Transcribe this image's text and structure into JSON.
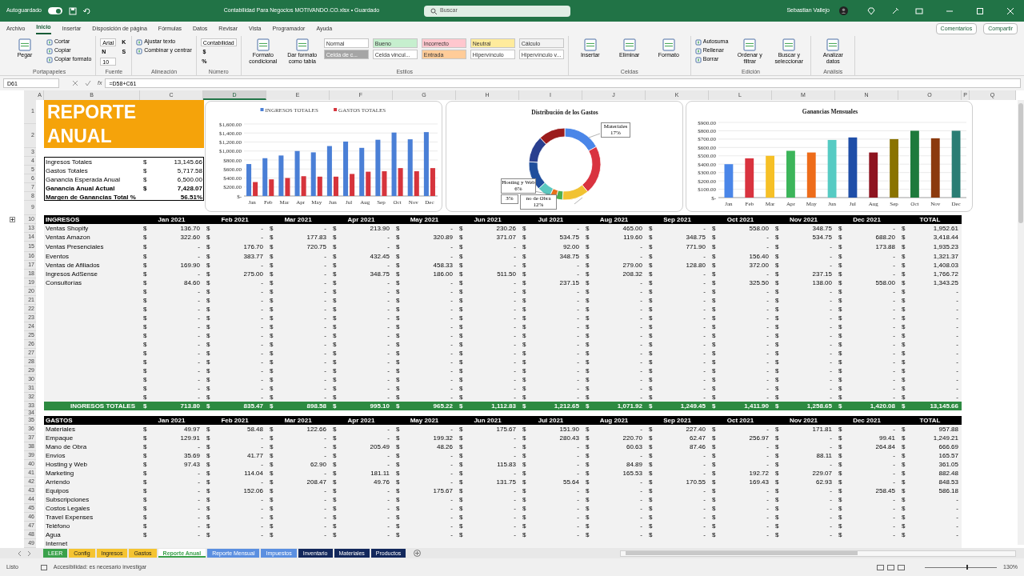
{
  "title_bar": {
    "autosave_label": "Autoguardado",
    "autosave_on": true,
    "document_title": "Contabilidad Para Negocios MOTIVANDO.CO.xlsx • Guardado",
    "search_placeholder": "Buscar",
    "user": "Sebastian Vallejo"
  },
  "menu_tabs": [
    {
      "label": "Archivo",
      "selected": false
    },
    {
      "label": "Inicio",
      "selected": true
    },
    {
      "label": "Insertar",
      "selected": false
    },
    {
      "label": "Disposición de página",
      "selected": false
    },
    {
      "label": "Fórmulas",
      "selected": false
    },
    {
      "label": "Datos",
      "selected": false
    },
    {
      "label": "Revisar",
      "selected": false
    },
    {
      "label": "Vista",
      "selected": false
    },
    {
      "label": "Programador",
      "selected": false
    },
    {
      "label": "Ayuda",
      "selected": false
    }
  ],
  "menu_actions": [
    "Comentarios",
    "Compartir"
  ],
  "ribbon": [
    {
      "label": "Portapapeles",
      "items": [
        {
          "kind": "large",
          "label": "Pegar"
        },
        {
          "kind": "small",
          "label": "Cortar"
        },
        {
          "kind": "small",
          "label": "Copiar"
        },
        {
          "kind": "small",
          "label": "Copiar formato"
        }
      ]
    },
    {
      "label": "Fuente",
      "items": [
        {
          "kind": "field",
          "label": "Arial"
        },
        {
          "kind": "char",
          "label": "N"
        },
        {
          "kind": "field",
          "label": "10"
        },
        {
          "kind": "char",
          "label": "K"
        },
        {
          "kind": "char",
          "label": "S"
        }
      ]
    },
    {
      "label": "Alineación",
      "items": [
        {
          "kind": "small",
          "label": "Ajustar texto"
        },
        {
          "kind": "small",
          "label": "Combinar y centrar"
        }
      ]
    },
    {
      "label": "Número",
      "items": [
        {
          "kind": "field",
          "label": "Contabilidad"
        },
        {
          "kind": "char",
          "label": "$"
        },
        {
          "kind": "char",
          "label": "%"
        }
      ]
    },
    {
      "label": "Estilos",
      "items": [
        {
          "kind": "large",
          "label": "Formato condicional"
        },
        {
          "kind": "large",
          "label": "Dar formato como tabla"
        },
        {
          "kind": "style",
          "label": "Normal",
          "color": "#ffffff"
        },
        {
          "kind": "style",
          "label": "Celda de c...",
          "color": "#a5a5a5"
        },
        {
          "kind": "style",
          "label": "Bueno",
          "color": "#c6efce"
        },
        {
          "kind": "style",
          "label": "Celda vincul...",
          "color": "#ffffff"
        },
        {
          "kind": "style",
          "label": "Incorrecto",
          "color": "#ffc7ce"
        },
        {
          "kind": "style",
          "label": "Entrada",
          "color": "#ffcc99"
        },
        {
          "kind": "style",
          "label": "Neutral",
          "color": "#ffeb9c"
        },
        {
          "kind": "style",
          "label": "Hipervínculo",
          "color": "#ffffff"
        },
        {
          "kind": "style",
          "label": "Cálculo",
          "color": "#f2f2f2"
        },
        {
          "kind": "style",
          "label": "Hipervínculo v...",
          "color": "#ffffff"
        }
      ]
    },
    {
      "label": "Celdas",
      "items": [
        {
          "kind": "large",
          "label": "Insertar"
        },
        {
          "kind": "large",
          "label": "Eliminar"
        },
        {
          "kind": "large",
          "label": "Formato"
        }
      ]
    },
    {
      "label": "Edición",
      "items": [
        {
          "kind": "small",
          "label": "Autosuma"
        },
        {
          "kind": "small",
          "label": "Rellenar"
        },
        {
          "kind": "small",
          "label": "Borrar"
        },
        {
          "kind": "large",
          "label": "Ordenar y filtrar"
        },
        {
          "kind": "large",
          "label": "Buscar y seleccionar"
        }
      ]
    },
    {
      "label": "Análisis",
      "items": [
        {
          "kind": "large",
          "label": "Analizar datos"
        }
      ]
    }
  ],
  "formula_bar": {
    "cell": "D61",
    "function_label": "fx",
    "formula": "=D58+C61"
  },
  "columns": [
    {
      "label": "A",
      "selected": false
    },
    {
      "label": "B",
      "selected": false
    },
    {
      "label": "C",
      "selected": false
    },
    {
      "label": "D",
      "selected": true
    },
    {
      "label": "E",
      "selected": false
    },
    {
      "label": "F",
      "selected": false
    },
    {
      "label": "G",
      "selected": false
    },
    {
      "label": "H",
      "selected": false
    },
    {
      "label": "I",
      "selected": false
    },
    {
      "label": "J",
      "selected": false
    },
    {
      "label": "K",
      "selected": false
    },
    {
      "label": "L",
      "selected": false
    },
    {
      "label": "M",
      "selected": false
    },
    {
      "label": "N",
      "selected": false
    },
    {
      "label": "O",
      "selected": false
    },
    {
      "label": "P",
      "selected": false
    },
    {
      "label": "Q",
      "selected": false
    }
  ],
  "top_rows": [
    "1",
    "2",
    "3",
    "4",
    "5",
    "6",
    "7",
    "8",
    "9"
  ],
  "report": {
    "title": "REPORTE ANUAL",
    "summary": [
      {
        "label": "Ingresos Totales",
        "currency": "$",
        "value": "13,145.66",
        "bold": false
      },
      {
        "label": "Gastos Totales",
        "currency": "$",
        "value": "5,717.58",
        "bold": false
      },
      {
        "label": "Ganancia Esperada Anual",
        "currency": "$",
        "value": "6,500.00",
        "bold": false
      },
      {
        "label": "Ganancia Anual Actual",
        "currency": "$",
        "value": "7,428.07",
        "bold": true
      },
      {
        "label": "Margen de Ganancias Total %",
        "value": "56.51%",
        "bold": true
      }
    ]
  },
  "income_chart": {
    "chart_data": {
      "type": "bar",
      "categories": [
        "Jan",
        "Feb",
        "Mar",
        "Apr",
        "May",
        "Jun",
        "Jul",
        "Aug",
        "Sep",
        "Oct",
        "Nov",
        "Dec"
      ],
      "series": [
        {
          "name": "INGRESOS TOTALES",
          "color": "#4a7fd6",
          "values": [
            710,
            840,
            900,
            1000,
            970,
            1110,
            1210,
            1070,
            1250,
            1410,
            1260,
            1420
          ]
        },
        {
          "name": "GASTOS TOTALES",
          "color": "#d6343c",
          "values": [
            310,
            370,
            400,
            440,
            430,
            430,
            490,
            540,
            550,
            620,
            550,
            620
          ]
        }
      ],
      "legend": "top",
      "grid": true,
      "ylim": [
        0,
        1600
      ],
      "yticks": [
        {
          "value": 0,
          "label": "$-"
        },
        {
          "value": 200,
          "label": "$200.00"
        },
        {
          "value": 400,
          "label": "$400.00"
        },
        {
          "value": 600,
          "label": "$600.00"
        },
        {
          "value": 800,
          "label": "$800.00"
        },
        {
          "value": 1000,
          "label": "$1,000.00"
        },
        {
          "value": 1200,
          "label": "$1,200.00"
        },
        {
          "value": 1400,
          "label": "$1,400.00"
        },
        {
          "value": 1600,
          "label": "$1,600.00"
        }
      ]
    }
  },
  "expense_donut": {
    "title": "Distribución de los Gastos",
    "callouts": [
      {
        "text": "Materiales",
        "percent": "17%"
      },
      {
        "text": "Hosting y Web",
        "percent": "6%"
      },
      {
        "percent": "3%"
      },
      {
        "text": "no de Obra",
        "percent": "12%"
      }
    ]
  },
  "profit_chart": {
    "chart_data": {
      "type": "bar",
      "title": "Ganancias Mensuales",
      "categories": [
        "Jan",
        "Feb",
        "Mar",
        "Apr",
        "May",
        "Jun",
        "Jul",
        "Aug",
        "Sep",
        "Oct",
        "Nov",
        "Dec"
      ],
      "series": [
        {
          "colors": [
            "#4a86e8",
            "#d9333f",
            "#f6c026",
            "#3cb55a",
            "#ee6c1a",
            "#56cbc3",
            "#1f4ea8",
            "#8e1420",
            "#8a7300",
            "#1e7a3c",
            "#8b3a0e",
            "#2a7d74"
          ],
          "values": [
            400,
            470,
            500,
            560,
            540,
            690,
            720,
            540,
            700,
            800,
            710,
            800
          ]
        }
      ],
      "grid": true,
      "ylim": [
        0,
        900
      ],
      "yticks": [
        {
          "value": 0,
          "label": "$-"
        },
        {
          "value": 100,
          "label": "$100.00"
        },
        {
          "value": 200,
          "label": "$200.00"
        },
        {
          "value": 300,
          "label": "$300.00"
        },
        {
          "value": 400,
          "label": "$400.00"
        },
        {
          "value": 500,
          "label": "$500.00"
        },
        {
          "value": 600,
          "label": "$600.00"
        },
        {
          "value": 700,
          "label": "$700.00"
        },
        {
          "value": 800,
          "label": "$800.00"
        },
        {
          "value": 900,
          "label": "$900.00"
        }
      ]
    }
  },
  "ingresos": {
    "row": "10",
    "header": [
      "INGRESOS",
      "Jan 2021",
      "Feb 2021",
      "Mar 2021",
      "Apr 2021",
      "May 2021",
      "Jun 2021",
      "Jul 2021",
      "Aug 2021",
      "Sep 2021",
      "Oct 2021",
      "Nov 2021",
      "Dec 2021",
      "TOTAL"
    ],
    "rows": [
      {
        "row": "13",
        "label": "Ventas Shopify",
        "cells": [
          "$",
          "136.70",
          "$",
          "-",
          "$",
          "-",
          "$",
          "213.90",
          "$",
          "-",
          "$",
          "230.26",
          "$",
          "-",
          "$",
          "465.00",
          "$",
          "-",
          "$",
          "558.00",
          "$",
          "348.75",
          "$",
          "-",
          "$",
          "1,952.61"
        ]
      },
      {
        "row": "14",
        "label": "Ventas Amazon",
        "cells": [
          "$",
          "322.60",
          "$",
          "-",
          "$",
          "177.83",
          "$",
          "-",
          "$",
          "320.89",
          "$",
          "371.07",
          "$",
          "534.75",
          "$",
          "119.60",
          "$",
          "348.75",
          "$",
          "-",
          "$",
          "534.75",
          "$",
          "688.20",
          "$",
          "3,418.44"
        ]
      },
      {
        "row": "15",
        "label": "Ventas Presenciales",
        "cells": [
          "$",
          "-",
          "$",
          "176.70",
          "$",
          "720.75",
          "$",
          "-",
          "$",
          "-",
          "$",
          "-",
          "$",
          "92.00",
          "$",
          "-",
          "$",
          "771.90",
          "$",
          "-",
          "$",
          "-",
          "$",
          "173.88",
          "$",
          "1,935.23"
        ]
      },
      {
        "row": "16",
        "label": "Eventos",
        "cells": [
          "$",
          "-",
          "$",
          "383.77",
          "$",
          "-",
          "$",
          "432.45",
          "$",
          "-",
          "$",
          "-",
          "$",
          "348.75",
          "$",
          "-",
          "$",
          "-",
          "$",
          "156.40",
          "$",
          "-",
          "$",
          "-",
          "$",
          "1,321.37"
        ]
      },
      {
        "row": "17",
        "label": "Ventas de Afiliados",
        "cells": [
          "$",
          "169.90",
          "$",
          "-",
          "$",
          "-",
          "$",
          "-",
          "$",
          "458.33",
          "$",
          "-",
          "$",
          "-",
          "$",
          "279.00",
          "$",
          "128.80",
          "$",
          "372.00",
          "$",
          "-",
          "$",
          "-",
          "$",
          "1,408.03"
        ]
      },
      {
        "row": "18",
        "label": "Ingresos AdSense",
        "cells": [
          "$",
          "-",
          "$",
          "275.00",
          "$",
          "-",
          "$",
          "348.75",
          "$",
          "186.00",
          "$",
          "511.50",
          "$",
          "-",
          "$",
          "208.32",
          "$",
          "-",
          "$",
          "-",
          "$",
          "237.15",
          "$",
          "-",
          "$",
          "1,766.72"
        ]
      },
      {
        "row": "19",
        "label": "Consultorías",
        "cells": [
          "$",
          "84.60",
          "$",
          "-",
          "$",
          "-",
          "$",
          "-",
          "$",
          "-",
          "$",
          "-",
          "$",
          "237.15",
          "$",
          "-",
          "$",
          "-",
          "$",
          "325.50",
          "$",
          "138.00",
          "$",
          "558.00",
          "$",
          "1,343.25"
        ]
      },
      {
        "row": "20",
        "cells": [
          "$",
          "-",
          "$",
          "-",
          "$",
          "-",
          "$",
          "-",
          "$",
          "-",
          "$",
          "-",
          "$",
          "-",
          "$",
          "-",
          "$",
          "-",
          "$",
          "-",
          "$",
          "-",
          "$",
          "-",
          "$",
          "-"
        ]
      },
      {
        "row": "21",
        "cells": [
          "$",
          "-",
          "$",
          "-",
          "$",
          "-",
          "$",
          "-",
          "$",
          "-",
          "$",
          "-",
          "$",
          "-",
          "$",
          "-",
          "$",
          "-",
          "$",
          "-",
          "$",
          "-",
          "$",
          "-",
          "$",
          "-"
        ]
      },
      {
        "row": "22",
        "cells": [
          "$",
          "-",
          "$",
          "-",
          "$",
          "-",
          "$",
          "-",
          "$",
          "-",
          "$",
          "-",
          "$",
          "-",
          "$",
          "-",
          "$",
          "-",
          "$",
          "-",
          "$",
          "-",
          "$",
          "-",
          "$",
          "-"
        ]
      },
      {
        "row": "23",
        "cells": [
          "$",
          "-",
          "$",
          "-",
          "$",
          "-",
          "$",
          "-",
          "$",
          "-",
          "$",
          "-",
          "$",
          "-",
          "$",
          "-",
          "$",
          "-",
          "$",
          "-",
          "$",
          "-",
          "$",
          "-",
          "$",
          "-"
        ]
      },
      {
        "row": "24",
        "cells": [
          "$",
          "-",
          "$",
          "-",
          "$",
          "-",
          "$",
          "-",
          "$",
          "-",
          "$",
          "-",
          "$",
          "-",
          "$",
          "-",
          "$",
          "-",
          "$",
          "-",
          "$",
          "-",
          "$",
          "-",
          "$",
          "-"
        ]
      },
      {
        "row": "25",
        "cells": [
          "$",
          "-",
          "$",
          "-",
          "$",
          "-",
          "$",
          "-",
          "$",
          "-",
          "$",
          "-",
          "$",
          "-",
          "$",
          "-",
          "$",
          "-",
          "$",
          "-",
          "$",
          "-",
          "$",
          "-",
          "$",
          "-"
        ]
      },
      {
        "row": "26",
        "cells": [
          "$",
          "-",
          "$",
          "-",
          "$",
          "-",
          "$",
          "-",
          "$",
          "-",
          "$",
          "-",
          "$",
          "-",
          "$",
          "-",
          "$",
          "-",
          "$",
          "-",
          "$",
          "-",
          "$",
          "-",
          "$",
          "-"
        ]
      },
      {
        "row": "27",
        "cells": [
          "$",
          "-",
          "$",
          "-",
          "$",
          "-",
          "$",
          "-",
          "$",
          "-",
          "$",
          "-",
          "$",
          "-",
          "$",
          "-",
          "$",
          "-",
          "$",
          "-",
          "$",
          "-",
          "$",
          "-",
          "$",
          "-"
        ]
      },
      {
        "row": "28",
        "cells": [
          "$",
          "-",
          "$",
          "-",
          "$",
          "-",
          "$",
          "-",
          "$",
          "-",
          "$",
          "-",
          "$",
          "-",
          "$",
          "-",
          "$",
          "-",
          "$",
          "-",
          "$",
          "-",
          "$",
          "-",
          "$",
          "-"
        ]
      },
      {
        "row": "29",
        "cells": [
          "$",
          "-",
          "$",
          "-",
          "$",
          "-",
          "$",
          "-",
          "$",
          "-",
          "$",
          "-",
          "$",
          "-",
          "$",
          "-",
          "$",
          "-",
          "$",
          "-",
          "$",
          "-",
          "$",
          "-",
          "$",
          "-"
        ]
      },
      {
        "row": "30",
        "cells": [
          "$",
          "-",
          "$",
          "-",
          "$",
          "-",
          "$",
          "-",
          "$",
          "-",
          "$",
          "-",
          "$",
          "-",
          "$",
          "-",
          "$",
          "-",
          "$",
          "-",
          "$",
          "-",
          "$",
          "-",
          "$",
          "-"
        ]
      },
      {
        "row": "31",
        "cells": [
          "$",
          "-",
          "$",
          "-",
          "$",
          "-",
          "$",
          "-",
          "$",
          "-",
          "$",
          "-",
          "$",
          "-",
          "$",
          "-",
          "$",
          "-",
          "$",
          "-",
          "$",
          "-",
          "$",
          "-",
          "$",
          "-"
        ]
      },
      {
        "row": "32",
        "cells": [
          "$",
          "-",
          "$",
          "-",
          "$",
          "-",
          "$",
          "-",
          "$",
          "-",
          "$",
          "-",
          "$",
          "-",
          "$",
          "-",
          "$",
          "-",
          "$",
          "-",
          "$",
          "-",
          "$",
          "-",
          "$",
          "-"
        ]
      }
    ],
    "total": {
      "row": "33",
      "label": "INGRESOS TOTALES",
      "cells": [
        "$",
        "713.80",
        "$",
        "835.47",
        "$",
        "898.58",
        "$",
        "995.10",
        "$",
        "965.22",
        "$",
        "1,112.83",
        "$",
        "1,212.65",
        "$",
        "1,071.92",
        "$",
        "1,249.45",
        "$",
        "1,411.90",
        "$",
        "1,258.65",
        "$",
        "1,420.08",
        "$",
        "13,145.66"
      ]
    }
  },
  "spacer_row": "34",
  "gastos": {
    "row": "35",
    "header": [
      "GASTOS",
      "Jan 2021",
      "Feb 2021",
      "Mar 2021",
      "Apr 2021",
      "May 2021",
      "Jun 2021",
      "Jul 2021",
      "Aug 2021",
      "Sep 2021",
      "Oct 2021",
      "Nov 2021",
      "Dec 2021",
      "TOTAL"
    ],
    "rows": [
      {
        "row": "36",
        "label": "Materiales",
        "cells": [
          "$",
          "49.97",
          "$",
          "58.48",
          "$",
          "122.66",
          "$",
          "-",
          "$",
          "-",
          "$",
          "175.67",
          "$",
          "151.90",
          "$",
          "-",
          "$",
          "227.40",
          "$",
          "-",
          "$",
          "171.81",
          "$",
          "-",
          "$",
          "957.88"
        ]
      },
      {
        "row": "37",
        "label": "Empaque",
        "cells": [
          "$",
          "129.91",
          "$",
          "-",
          "$",
          "-",
          "$",
          "-",
          "$",
          "199.32",
          "$",
          "-",
          "$",
          "280.43",
          "$",
          "220.70",
          "$",
          "62.47",
          "$",
          "256.97",
          "$",
          "-",
          "$",
          "99.41",
          "$",
          "1,249.21"
        ]
      },
      {
        "row": "38",
        "label": "Mano de Obra",
        "cells": [
          "$",
          "-",
          "$",
          "-",
          "$",
          "-",
          "$",
          "205.49",
          "$",
          "48.26",
          "$",
          "-",
          "$",
          "-",
          "$",
          "60.63",
          "$",
          "87.46",
          "$",
          "-",
          "$",
          "-",
          "$",
          "264.84",
          "$",
          "666.69"
        ]
      },
      {
        "row": "39",
        "label": "Envíos",
        "cells": [
          "$",
          "35.69",
          "$",
          "41.77",
          "$",
          "-",
          "$",
          "-",
          "$",
          "-",
          "$",
          "-",
          "$",
          "-",
          "$",
          "-",
          "$",
          "-",
          "$",
          "-",
          "$",
          "88.11",
          "$",
          "-",
          "$",
          "165.57"
        ]
      },
      {
        "row": "40",
        "label": "Hosting y Web",
        "cells": [
          "$",
          "97.43",
          "$",
          "-",
          "$",
          "62.90",
          "$",
          "-",
          "$",
          "-",
          "$",
          "115.83",
          "$",
          "-",
          "$",
          "84.89",
          "$",
          "-",
          "$",
          "-",
          "$",
          "-",
          "$",
          "-",
          "$",
          "361.05"
        ]
      },
      {
        "row": "41",
        "label": "Marketing",
        "cells": [
          "$",
          "-",
          "$",
          "114.04",
          "$",
          "-",
          "$",
          "181.11",
          "$",
          "-",
          "$",
          "-",
          "$",
          "-",
          "$",
          "165.53",
          "$",
          "-",
          "$",
          "192.72",
          "$",
          "229.07",
          "$",
          "-",
          "$",
          "882.48"
        ]
      },
      {
        "row": "42",
        "label": "Arriendo",
        "cells": [
          "$",
          "-",
          "$",
          "-",
          "$",
          "208.47",
          "$",
          "49.76",
          "$",
          "-",
          "$",
          "131.75",
          "$",
          "55.64",
          "$",
          "-",
          "$",
          "170.55",
          "$",
          "169.43",
          "$",
          "62.93",
          "$",
          "-",
          "$",
          "848.53"
        ]
      },
      {
        "row": "43",
        "label": "Equipos",
        "cells": [
          "$",
          "-",
          "$",
          "152.06",
          "$",
          "-",
          "$",
          "-",
          "$",
          "175.67",
          "$",
          "-",
          "$",
          "-",
          "$",
          "-",
          "$",
          "-",
          "$",
          "-",
          "$",
          "-",
          "$",
          "258.45",
          "$",
          "586.18"
        ]
      },
      {
        "row": "44",
        "label": "Subscripciones",
        "cells": [
          "$",
          "-",
          "$",
          "-",
          "$",
          "-",
          "$",
          "-",
          "$",
          "-",
          "$",
          "-",
          "$",
          "-",
          "$",
          "-",
          "$",
          "-",
          "$",
          "-",
          "$",
          "-",
          "$",
          "-",
          "$",
          "-"
        ]
      },
      {
        "row": "45",
        "label": "Costos Legales",
        "cells": [
          "$",
          "-",
          "$",
          "-",
          "$",
          "-",
          "$",
          "-",
          "$",
          "-",
          "$",
          "-",
          "$",
          "-",
          "$",
          "-",
          "$",
          "-",
          "$",
          "-",
          "$",
          "-",
          "$",
          "-",
          "$",
          "-"
        ]
      },
      {
        "row": "46",
        "label": "Travel Expenses",
        "cells": [
          "$",
          "-",
          "$",
          "-",
          "$",
          "-",
          "$",
          "-",
          "$",
          "-",
          "$",
          "-",
          "$",
          "-",
          "$",
          "-",
          "$",
          "-",
          "$",
          "-",
          "$",
          "-",
          "$",
          "-",
          "$",
          "-"
        ]
      },
      {
        "row": "47",
        "label": "Teléfono",
        "cells": [
          "$",
          "-",
          "$",
          "-",
          "$",
          "-",
          "$",
          "-",
          "$",
          "-",
          "$",
          "-",
          "$",
          "-",
          "$",
          "-",
          "$",
          "-",
          "$",
          "-",
          "$",
          "-",
          "$",
          "-",
          "$",
          "-"
        ]
      },
      {
        "row": "48",
        "label": "Agua",
        "cells": [
          "$",
          "-",
          "$",
          "-",
          "$",
          "-",
          "$",
          "-",
          "$",
          "-",
          "$",
          "-",
          "$",
          "-",
          "$",
          "-",
          "$",
          "-",
          "$",
          "-",
          "$",
          "-",
          "$",
          "-",
          "$",
          "-"
        ]
      },
      {
        "row": "49",
        "label": "Internet"
      }
    ]
  },
  "sheet_tabs": [
    {
      "label": "LEER",
      "color": "#3aa14a",
      "selected": false
    },
    {
      "label": "Config",
      "color": "#f5c431",
      "selected": false
    },
    {
      "label": "Ingresos",
      "color": "#f5c431",
      "selected": false
    },
    {
      "label": "Gastos",
      "color": "#f5c431",
      "selected": false
    },
    {
      "label": "Reporte Anual",
      "color": "#3aa14a",
      "selected": true
    },
    {
      "label": "Reporte Mensual",
      "color": "#5b8fe0",
      "selected": false
    },
    {
      "label": "Impuestos",
      "color": "#5b8fe0",
      "selected": false
    },
    {
      "label": "Inventario",
      "color": "#13285c",
      "selected": false
    },
    {
      "label": "Materiales",
      "color": "#13285c",
      "selected": false
    },
    {
      "label": "Productos",
      "color": "#13285c",
      "selected": false
    }
  ],
  "status_bar": {
    "status": "Listo",
    "accessibility": "Accesibilidad: es necesario investigar",
    "zoom": "130%",
    "zoom_slider": {
      "level": 0.58
    }
  }
}
